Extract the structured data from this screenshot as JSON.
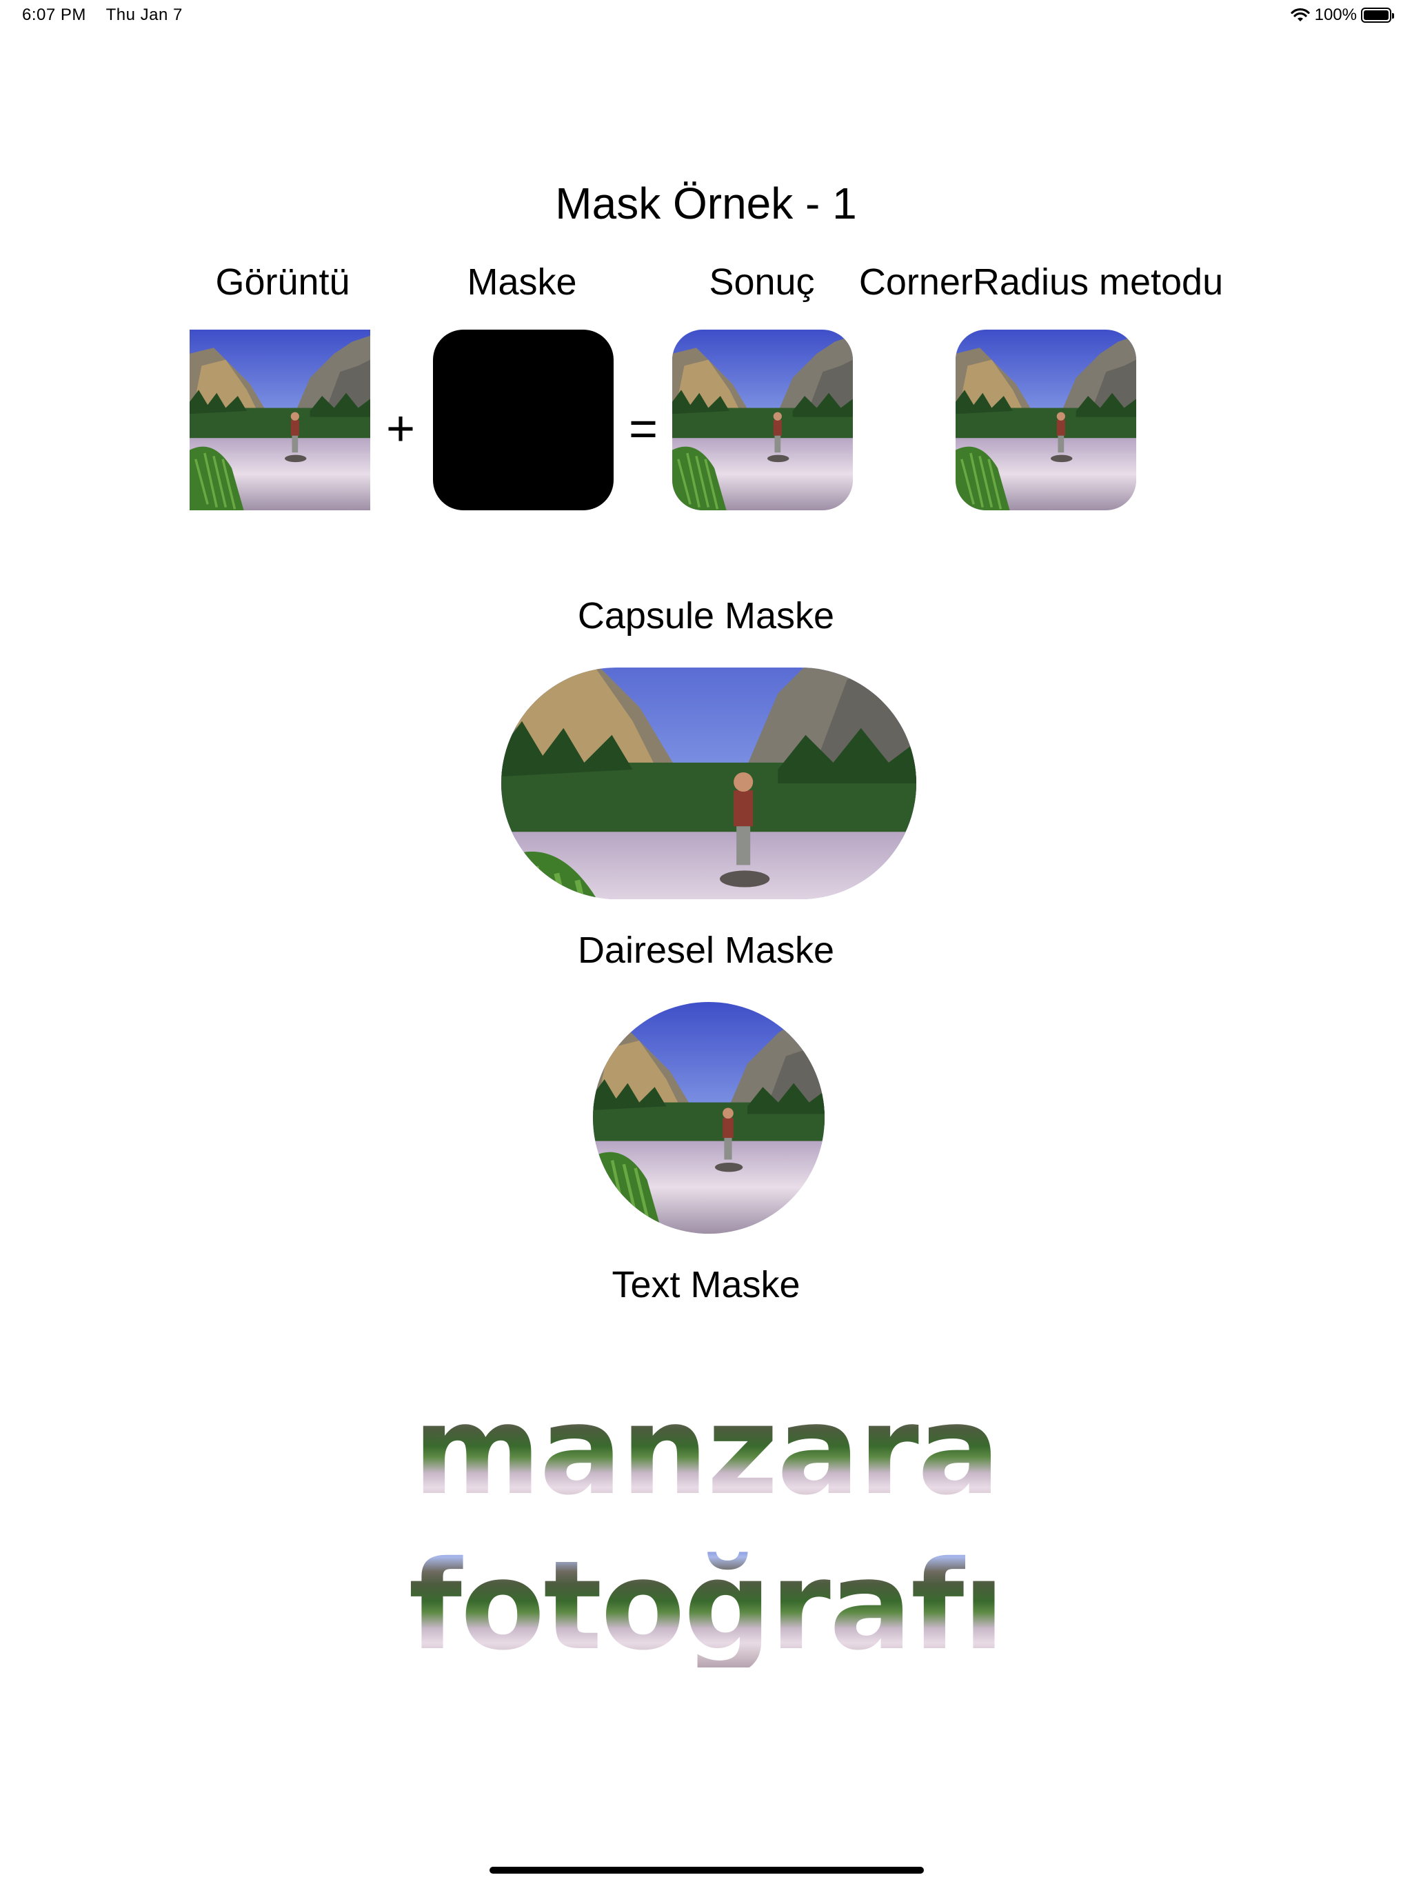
{
  "status_bar": {
    "time": "6:07 PM",
    "date": "Thu Jan 7",
    "battery": "100%"
  },
  "title": "Mask Örnek - 1",
  "columns": {
    "image": "Görüntü",
    "mask": "Maske",
    "result": "Sonuç",
    "corner_radius": "CornerRadius metodu"
  },
  "operators": {
    "plus": "+",
    "equals": "="
  },
  "sections": {
    "capsule": "Capsule Maske",
    "circle": "Dairesel Maske",
    "text": "Text Maske"
  },
  "text_mask": {
    "line1": "manzara",
    "line2": "fotoğrafı"
  },
  "icons": [
    "wifi-icon",
    "battery-icon"
  ]
}
